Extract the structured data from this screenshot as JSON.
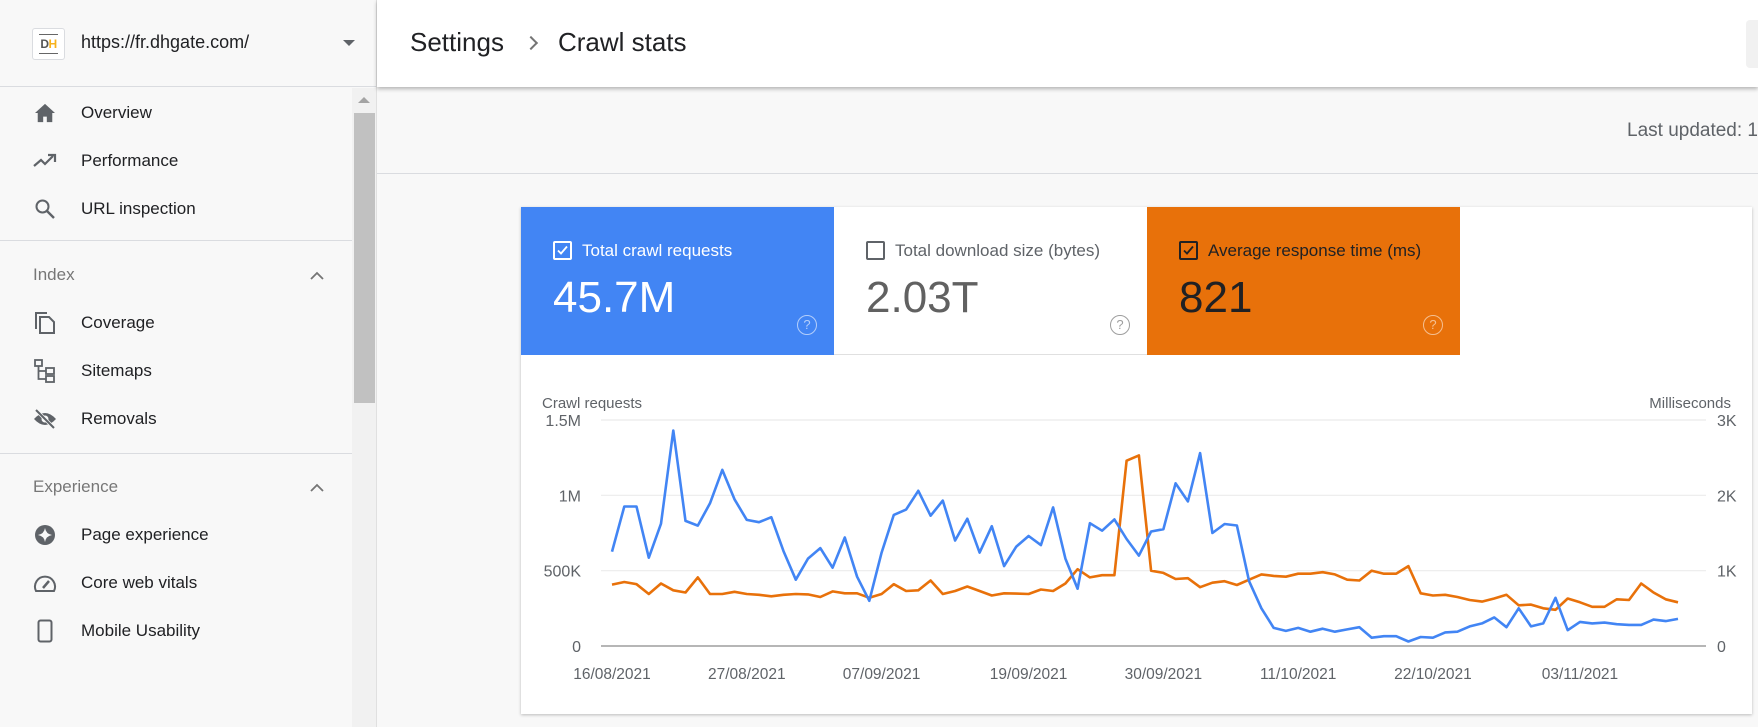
{
  "property": {
    "logo_text_a": "D",
    "logo_text_b": "H",
    "url": "https://fr.dhgate.com/",
    "dropdown_icon": "arrow-drop-down-icon"
  },
  "sidebar": {
    "items": [
      {
        "label": "Overview",
        "icon": "home-icon"
      },
      {
        "label": "Performance",
        "icon": "trending-up-icon"
      },
      {
        "label": "URL inspection",
        "icon": "search-icon"
      }
    ],
    "sections": [
      {
        "title": "Index",
        "expanded": true,
        "items": [
          {
            "label": "Coverage",
            "icon": "file-copy-icon"
          },
          {
            "label": "Sitemaps",
            "icon": "sitemap-icon"
          },
          {
            "label": "Removals",
            "icon": "visibility-off-icon"
          }
        ]
      },
      {
        "title": "Experience",
        "expanded": true,
        "items": [
          {
            "label": "Page experience",
            "icon": "page-experience-icon"
          },
          {
            "label": "Core web vitals",
            "icon": "speedometer-icon"
          },
          {
            "label": "Mobile Usability",
            "icon": "smartphone-icon"
          }
        ]
      }
    ]
  },
  "header": {
    "breadcrumb": [
      "Settings",
      "Crawl stats"
    ]
  },
  "main": {
    "last_updated_label": "Last updated: 1"
  },
  "metrics": [
    {
      "label": "Total crawl requests",
      "value": "45.7M",
      "checked": true,
      "color": "#4285f4"
    },
    {
      "label": "Total download size (bytes)",
      "value": "2.03T",
      "checked": false,
      "color": "#ffffff"
    },
    {
      "label": "Average response time (ms)",
      "value": "821",
      "checked": true,
      "color": "#e8710a"
    }
  ],
  "chart_data": {
    "type": "line",
    "title": "",
    "start_date": "16/08/2021",
    "x_tick_labels": [
      "16/08/2021",
      "27/08/2021",
      "07/09/2021",
      "19/09/2021",
      "30/09/2021",
      "11/10/2021",
      "22/10/2021",
      "03/11/2021"
    ],
    "x_tick_day_offsets": [
      0,
      11,
      22,
      34,
      45,
      56,
      67,
      79
    ],
    "left_axis": {
      "label": "Crawl requests",
      "ticks": [
        "0",
        "500K",
        "1M",
        "1.5M"
      ],
      "range": [
        0,
        1500000
      ]
    },
    "right_axis": {
      "label": "Milliseconds",
      "ticks": [
        "0",
        "1K",
        "2K",
        "3K"
      ],
      "range": [
        0,
        3000
      ]
    },
    "grid": true,
    "legend": "none",
    "series": [
      {
        "name": "Total crawl requests",
        "axis": "left",
        "color": "#4285f4",
        "values": [
          626000,
          926000,
          926000,
          586000,
          812000,
          1430000,
          830000,
          799000,
          947000,
          1169000,
          974000,
          837000,
          822000,
          855000,
          630000,
          440000,
          580000,
          650000,
          520000,
          720000,
          460000,
          300000,
          620000,
          870000,
          905000,
          1030000,
          865000,
          965000,
          700000,
          845000,
          620000,
          795000,
          530000,
          660000,
          730000,
          670000,
          920000,
          580000,
          380000,
          815000,
          765000,
          840000,
          710000,
          600000,
          760000,
          775000,
          1080000,
          960000,
          1280000,
          750000,
          810000,
          800000,
          430000,
          250000,
          120000,
          100000,
          120000,
          95000,
          115000,
          95000,
          110000,
          125000,
          55000,
          65000,
          65000,
          30000,
          60000,
          55000,
          90000,
          95000,
          130000,
          150000,
          190000,
          125000,
          250000,
          130000,
          150000,
          320000,
          105000,
          160000,
          150000,
          155000,
          145000,
          140000,
          140000,
          175000,
          165000,
          180000
        ]
      },
      {
        "name": "Average response time (ms)",
        "axis": "right",
        "color": "#e8710a",
        "values": [
          815,
          850,
          820,
          690,
          830,
          740,
          710,
          910,
          690,
          690,
          720,
          690,
          680,
          660,
          680,
          690,
          685,
          650,
          725,
          700,
          700,
          640,
          690,
          820,
          730,
          740,
          870,
          690,
          730,
          790,
          730,
          670,
          700,
          695,
          690,
          750,
          730,
          830,
          1020,
          910,
          940,
          940,
          2460,
          2530,
          1000,
          970,
          890,
          900,
          780,
          840,
          860,
          810,
          880,
          950,
          930,
          920,
          960,
          960,
          980,
          950,
          880,
          870,
          1000,
          960,
          960,
          1060,
          700,
          670,
          680,
          650,
          610,
          590,
          630,
          680,
          540,
          550,
          500,
          480,
          630,
          580,
          520,
          520,
          620,
          610,
          830,
          710,
          620,
          580
        ]
      }
    ]
  }
}
